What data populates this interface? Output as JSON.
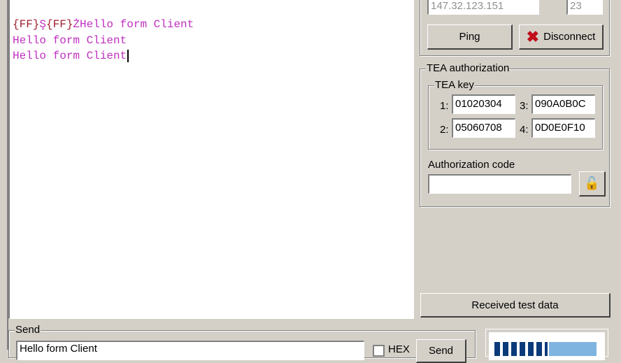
{
  "terminal": {
    "lines": [
      {
        "prefix1": "{FF}",
        "mid1": "Ş",
        "prefix2": "{FF}",
        "mid2": "ŻHello form Client"
      },
      {
        "text": "Hello form Client"
      },
      {
        "text": ""
      },
      {
        "text": "Hello form Client"
      }
    ]
  },
  "connection": {
    "ip": "147.32.123.151",
    "port": "23",
    "ping_label": "Ping",
    "disconnect_label": "Disconnect"
  },
  "tea": {
    "title": "TEA authorization",
    "key_title": "TEA key",
    "keys": [
      {
        "label": "1:",
        "value": "01020304"
      },
      {
        "label": "2:",
        "value": "05060708"
      },
      {
        "label": "3:",
        "value": "090A0B0C"
      },
      {
        "label": "4:",
        "value": "0D0E0F10"
      }
    ],
    "auth_code_label": "Authorization code",
    "auth_code_value": ""
  },
  "received_test_button": "Received test data",
  "send": {
    "title": "Send",
    "input_value": "Hello form Client",
    "hex_label": "HEX",
    "send_label": "Send"
  },
  "colors": {
    "terminal_text": "#c030c0",
    "escape_text": "#a02030",
    "disconnect_icon": "#c0101a"
  }
}
